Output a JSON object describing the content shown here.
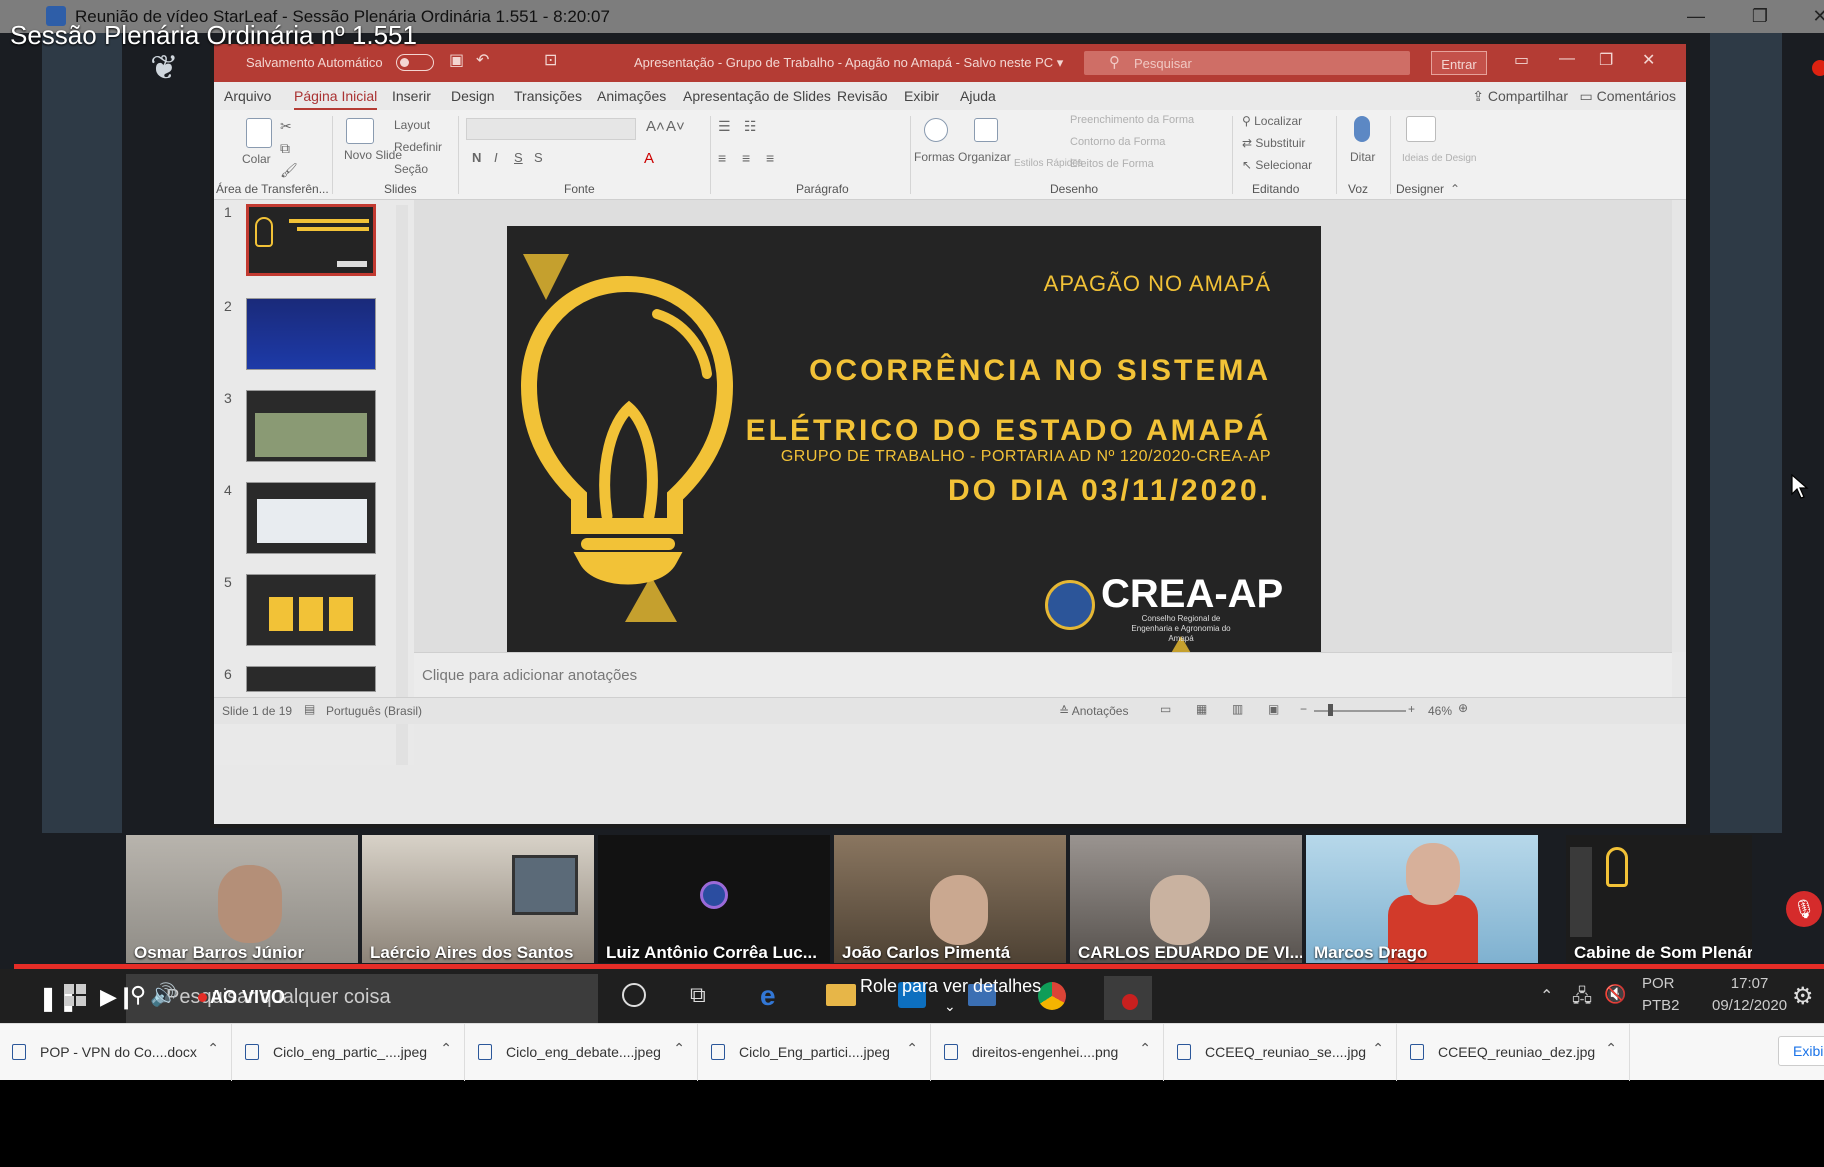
{
  "window": {
    "title": "Reunião de vídeo StarLeaf - Sessão Plenária Ordinária 1.551 - 8:20:07"
  },
  "video_title": "Sessão Plenária Ordinária nº 1.551",
  "ppt": {
    "autosave_label": "Salvamento Automático",
    "doc_title": "Apresentação - Grupo de Trabalho - Apagão no Amapá  -  Salvo neste PC ▾",
    "search_placeholder": "Pesquisar",
    "enter_label": "Entrar",
    "tabs": [
      "Arquivo",
      "Página Inicial",
      "Inserir",
      "Design",
      "Transições",
      "Animações",
      "Apresentação de Slides",
      "Revisão",
      "Exibir",
      "Ajuda"
    ],
    "share_label": "Compartilhar",
    "comments_label": "Comentários",
    "ribbon": {
      "clipboard": {
        "paste": "Colar",
        "group": "Área de Transferên..."
      },
      "slides": {
        "new_slide": "Novo Slide",
        "layout": "Layout",
        "reset": "Redefinir",
        "section": "Seção",
        "group": "Slides"
      },
      "font": {
        "group": "Fonte",
        "bold": "N",
        "italic": "I",
        "underline": "S",
        "strike": "S"
      },
      "paragraph": {
        "group": "Parágrafo"
      },
      "drawing": {
        "shapes": "Formas",
        "arrange": "Organizar",
        "quick_styles": "Estilos Rápidos",
        "fill": "Preenchimento da Forma",
        "outline": "Contorno da Forma",
        "effects": "Efeitos de Forma",
        "group": "Desenho"
      },
      "editing": {
        "find": "Localizar",
        "replace": "Substituir",
        "select": "Selecionar",
        "group": "Editando"
      },
      "voice": {
        "dictate": "Ditar",
        "group": "Voz"
      },
      "designer": {
        "ideas": "Ideias de Design",
        "group": "Designer"
      }
    },
    "thumbnails": [
      "1",
      "2",
      "3",
      "4",
      "5",
      "6"
    ],
    "notes_placeholder": "Clique para adicionar anotações",
    "status": {
      "slide": "Slide 1 de 19",
      "language": "Português (Brasil)",
      "notes": "Anotações",
      "zoom": "46%"
    }
  },
  "slide": {
    "subtitle": "APAGÃO NO AMAPÁ",
    "title_lines": [
      "OCORRÊNCIA NO SISTEMA",
      "ELÉTRICO DO ESTADO AMAPÁ",
      "DO DIA 03/11/2020."
    ],
    "group": "GRUPO DE TRABALHO - PORTARIA AD Nº 120/2020-CREA-AP",
    "logo": "CREA-AP",
    "logo_sub": "Conselho Regional de Engenharia e Agronomia do Amapá",
    "accent": "#f2c237"
  },
  "participants": [
    {
      "name": "Osmar Barros Júnior",
      "bg": "#8f8c86"
    },
    {
      "name": "Laércio Aires dos Santos",
      "bg": "#9a958c"
    },
    {
      "name": "Luiz Antônio Corrêa Luc...",
      "bg": "#121212"
    },
    {
      "name": "João Carlos Pimentá",
      "bg": "#6c5c48"
    },
    {
      "name": "CARLOS EDUARDO DE VI...",
      "bg": "#6f6a66"
    },
    {
      "name": "Marcos Drago",
      "bg": "#2f7fb4"
    },
    {
      "name": "Cabine de Som Plenário",
      "bg": "#1c1c1c"
    }
  ],
  "player": {
    "live_label": "AO VIVO",
    "taskbar_search": "Pesquisar qualquer coisa",
    "details_label": "Role para ver detalhes",
    "lang1": "POR",
    "lang2": "PTB2",
    "time": "17:07",
    "date": "09/12/2020"
  },
  "downloads": [
    "POP - VPN do Co....docx",
    "Ciclo_eng_partic_....jpeg",
    "Ciclo_eng_debate....jpeg",
    "Ciclo_Eng_partici....jpeg",
    "direitos-engenhei....png",
    "CCEEQ_reuniao_se....jpg",
    "CCEEQ_reuniao_dez.jpg"
  ],
  "downloads_show_all": "Exibir"
}
